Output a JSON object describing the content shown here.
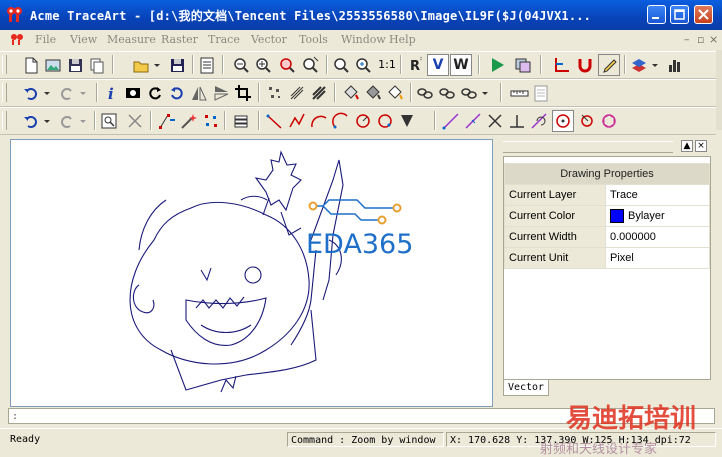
{
  "window": {
    "title": "Acme TraceArt - [d:\\我的文档\\Tencent Files\\2553556580\\Image\\IL9F($J(04JVX1..."
  },
  "menu": [
    "File",
    "View",
    "Measure",
    "Raster",
    "Trace",
    "Vector",
    "Tools",
    "Window",
    "Help"
  ],
  "toolbar": {
    "scale_label": "1:1",
    "v_label": "V",
    "w_label": "W"
  },
  "canvas": {
    "logo_text": "EDA365",
    "logo_color": "#1e6fc9",
    "stroke_color": "#1a1a7a"
  },
  "panel": {
    "title": "Drawing Properties",
    "rows": [
      {
        "key": "Current Layer",
        "value": "Trace"
      },
      {
        "key": "Current Color",
        "value": "Bylayer",
        "swatch": "#0000ff"
      },
      {
        "key": "Current Width",
        "value": "0.000000"
      },
      {
        "key": "Current Unit",
        "value": "Pixel"
      }
    ],
    "tab": "Vector"
  },
  "cmdline": ":",
  "status": {
    "ready": "Ready",
    "command": "Command : Zoom by window",
    "coords": "X: 170.628 Y: 137.390 W:125 H:134 dpi:72"
  },
  "watermark": {
    "main": "易迪拓培训",
    "sub": "射频和天线设计专家"
  }
}
